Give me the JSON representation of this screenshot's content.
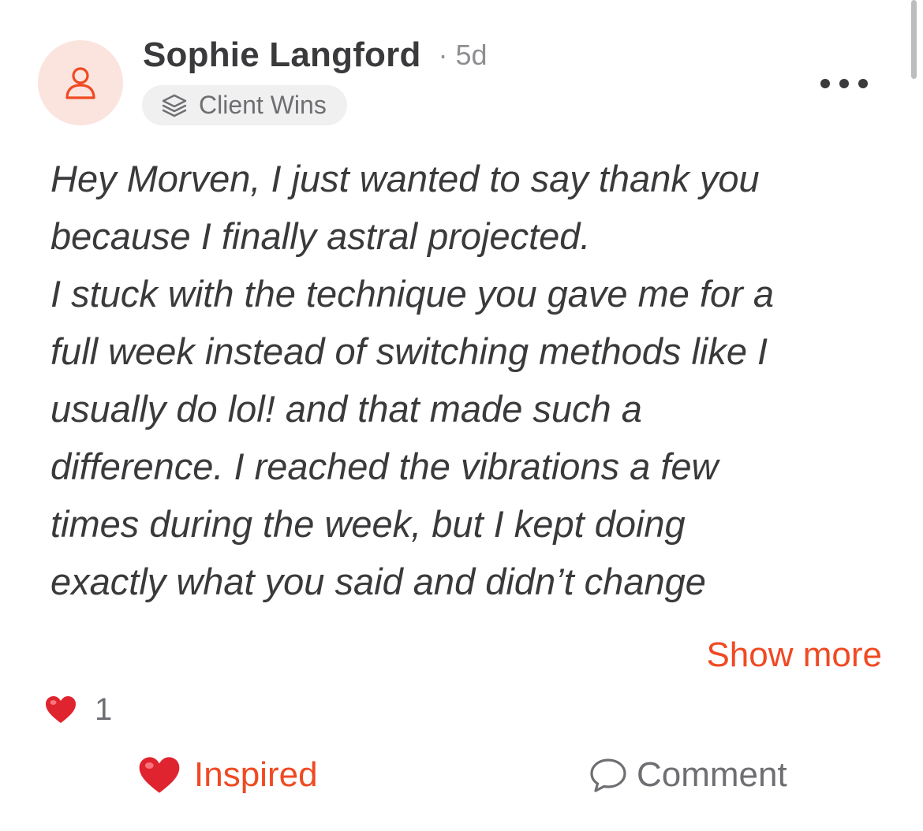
{
  "post": {
    "author": {
      "name": "Sophie Langford",
      "separator": "·",
      "age": "5d",
      "avatar_icon": "user-icon"
    },
    "category": {
      "icon": "layers-icon",
      "label": "Client Wins"
    },
    "menu_icon": "more-horizontal-icon",
    "body_lines": [
      "Hey Morven, I just wanted to say thank you",
      "because I finally astral projected.",
      "I stuck with the technique you gave me for a",
      "full week instead of switching methods like I",
      "usually do lol! and that made such a",
      "difference. I reached the vibrations a few",
      "times during the week, but I kept doing",
      "exactly what you said and didn’t change"
    ],
    "show_more_label": "Show more",
    "reactions": {
      "icon": "heart-icon",
      "count": "1"
    },
    "actions": {
      "inspired_label": "Inspired",
      "inspired_icon": "heart-icon",
      "comment_label": "Comment",
      "comment_icon": "speech-bubble-icon"
    }
  },
  "colors": {
    "accent": "#f04a23",
    "text_primary": "#3a3a3c",
    "text_secondary": "#8e8e93",
    "avatar_bg": "#fbe4de",
    "pill_bg": "#f0f0f0",
    "heart": "#e0242f"
  }
}
